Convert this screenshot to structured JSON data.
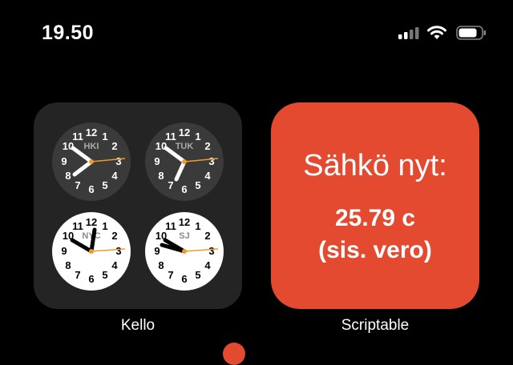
{
  "status_bar": {
    "time": "19.50",
    "icons": [
      "signal-icon",
      "wifi-icon",
      "battery-icon"
    ]
  },
  "widgets": [
    {
      "app_label": "Kello",
      "clocks": [
        {
          "city": "HKI",
          "face": "dark",
          "time": "7:50"
        },
        {
          "city": "TUK",
          "face": "dark",
          "time": "6:50"
        },
        {
          "city": "NYC",
          "face": "light",
          "time": "12:50"
        },
        {
          "city": "SJ",
          "face": "light",
          "time": "10:50"
        }
      ]
    },
    {
      "app_label": "Scriptable",
      "title": "Sähkö nyt:",
      "value": "25.79 c",
      "note": "(sis. vero)",
      "background": "#e34a30"
    }
  ],
  "colors": {
    "background": "#000000",
    "clock_widget_bg": "#242424",
    "dark_face": "#3a3a3a",
    "light_face": "#ffffff",
    "second_hand": "#f09a2a"
  }
}
